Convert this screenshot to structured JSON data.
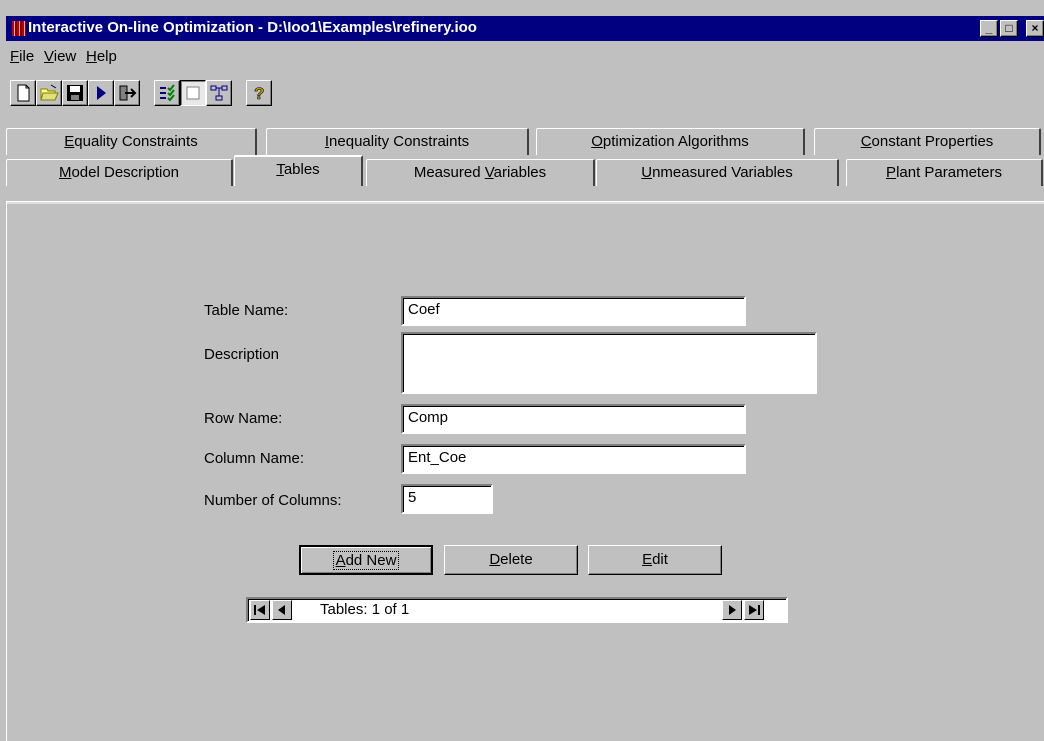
{
  "window": {
    "title": "Interactive On-line Optimization - D:\\Ioo1\\Examples\\refinery.ioo",
    "controls": {
      "minimize": "_",
      "maximize": "□",
      "close": "×"
    }
  },
  "menu": {
    "file": {
      "mnemonic": "F",
      "rest": "ile"
    },
    "view": {
      "mnemonic": "V",
      "rest": "iew"
    },
    "help": {
      "mnemonic": "H",
      "rest": "elp"
    }
  },
  "toolbar": {
    "icons": [
      "new-file-icon",
      "open-folder-icon",
      "save-icon",
      "run-icon",
      "exit-icon",
      "checklist-icon",
      "blank-page-icon",
      "diagram-icon",
      "help-icon"
    ],
    "help_glyph": "?"
  },
  "tabs": {
    "row_back": [
      {
        "pre": "",
        "mn": "E",
        "post": "quality Constraints"
      },
      {
        "pre": "",
        "mn": "I",
        "post": "nequality Constraints"
      },
      {
        "pre": "",
        "mn": "O",
        "post": "ptimization Algorithms"
      },
      {
        "pre": "",
        "mn": "C",
        "post": "onstant Properties"
      }
    ],
    "row_front": [
      {
        "pre": "",
        "mn": "M",
        "post": "odel Description"
      },
      {
        "pre": "",
        "mn": "T",
        "post": "ables"
      },
      {
        "pre": "Measured ",
        "mn": "V",
        "post": "ariables"
      },
      {
        "pre": "",
        "mn": "U",
        "post": "nmeasured Variables"
      },
      {
        "pre": "",
        "mn": "P",
        "post": "lant Parameters"
      }
    ],
    "active": "Tables"
  },
  "form": {
    "table_name": {
      "label": "Table Name:",
      "value": "Coef"
    },
    "description": {
      "label": "Description",
      "value": ""
    },
    "row_name": {
      "label": "Row Name:",
      "value": "Comp"
    },
    "column_name": {
      "label": "Column Name:",
      "value": "Ent_Coe"
    },
    "num_columns": {
      "label": "Number of Columns:",
      "value": "5"
    }
  },
  "buttons": {
    "add_new": {
      "mn": "A",
      "post": "dd New"
    },
    "delete": {
      "mn": "D",
      "post": "elete"
    },
    "edit": {
      "mn": "E",
      "post": "dit"
    }
  },
  "navigator": {
    "text": "Tables: 1 of 1"
  }
}
